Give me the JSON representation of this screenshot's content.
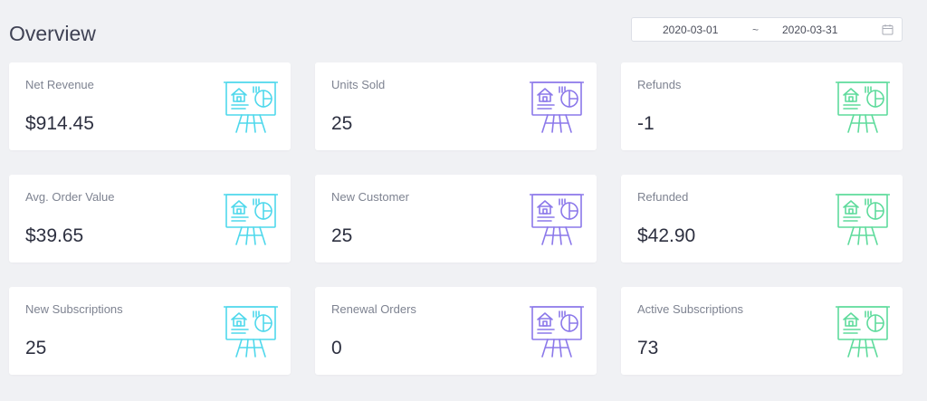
{
  "header": {
    "title": "Overview",
    "date_range": {
      "start": "2020-03-01",
      "separator": "~",
      "end": "2020-03-31",
      "icon": "calendar-icon"
    }
  },
  "colors": {
    "cyan": "#4fd8ec",
    "purple": "#8b78ea",
    "green": "#5edb9c"
  },
  "cards": [
    {
      "label": "Net Revenue",
      "value": "$914.45",
      "icon": "presentation-board-icon"
    },
    {
      "label": "Units Sold",
      "value": "25",
      "icon": "presentation-board-icon"
    },
    {
      "label": "Refunds",
      "value": "-1",
      "icon": "presentation-board-icon"
    },
    {
      "label": "Avg. Order Value",
      "value": "$39.65",
      "icon": "presentation-board-icon"
    },
    {
      "label": "New Customer",
      "value": "25",
      "icon": "presentation-board-icon"
    },
    {
      "label": "Refunded",
      "value": "$42.90",
      "icon": "presentation-board-icon"
    },
    {
      "label": "New Subscriptions",
      "value": "25",
      "icon": "presentation-board-icon"
    },
    {
      "label": "Renewal Orders",
      "value": "0",
      "icon": "presentation-board-icon"
    },
    {
      "label": "Active Subscriptions",
      "value": "73",
      "icon": "presentation-board-icon"
    }
  ]
}
